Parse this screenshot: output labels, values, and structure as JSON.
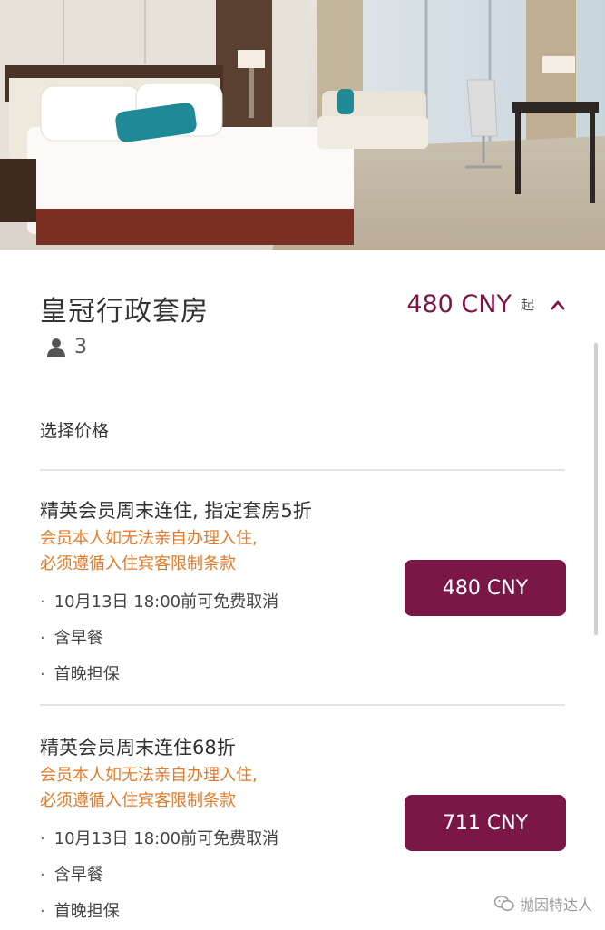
{
  "room": {
    "name": "皇冠行政套房",
    "price_from": "480 CNY",
    "price_from_suffix": "起",
    "guests": "3"
  },
  "section_label": "选择价格",
  "rates": [
    {
      "name": "精英会员周末连住, 指定套房5折",
      "notice_line1": "会员本人如无法亲自办理入住,",
      "notice_line2": "必须遵循入住宾客限制条款",
      "bullet": "·",
      "items": [
        "10月13日 18:00前可免费取消",
        "含早餐",
        "首晚担保"
      ],
      "price": "480 CNY"
    },
    {
      "name": "精英会员周末连住68折",
      "notice_line1": "会员本人如无法亲自办理入住,",
      "notice_line2": "必须遵循入住宾客限制条款",
      "bullet": "·",
      "items": [
        "10月13日 18:00前可免费取消",
        "含早餐",
        "首晚担保"
      ],
      "price": "711 CNY"
    }
  ],
  "watermark": "抛因特达人",
  "icons": {
    "guests": "person-icon",
    "collapse": "chevron-up-icon",
    "watermark": "wechat-icon"
  },
  "colors": {
    "accent": "#7a1747",
    "notice": "#e07b2a",
    "divider": "#e3e3e3"
  }
}
